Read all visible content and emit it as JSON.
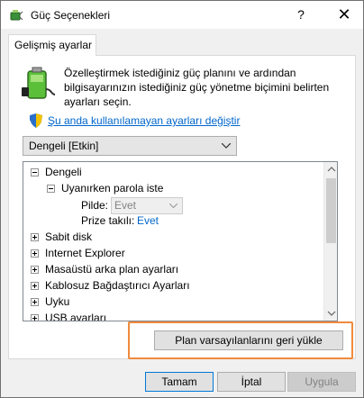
{
  "window": {
    "title": "Güç Seçenekleri",
    "help_glyph": "?",
    "close_glyph": "✕"
  },
  "tab": {
    "label": "Gelişmiş ayarlar"
  },
  "description": "Özelleştirmek istediğiniz güç planını ve ardından bilgisayarınızın istediğiniz güç yönetme biçimini belirten ayarları seçin.",
  "change_link": "Şu anda kullanılamayan ayarları değiştir",
  "plan_dropdown": {
    "value": "Dengeli [Etkin]"
  },
  "tree": {
    "root": "Dengeli",
    "wake_password": {
      "label": "Uyanırken parola iste",
      "battery_label": "Pilde:",
      "battery_value": "Evet",
      "plugged_label": "Prize takılı:",
      "plugged_value": "Evet"
    },
    "items": [
      "Sabit disk",
      "Internet Explorer",
      "Masaüstü arka plan ayarları",
      "Kablosuz Bağdaştırıcı Ayarları",
      "Uyku",
      "USB ayarları"
    ]
  },
  "restore_button": "Plan varsayılanlarını geri yükle",
  "buttons": {
    "ok": "Tamam",
    "cancel": "İptal",
    "apply": "Uygula"
  },
  "colors": {
    "link": "#0066cc",
    "highlight": "#f08a3c",
    "focus_border": "#0078d7"
  }
}
